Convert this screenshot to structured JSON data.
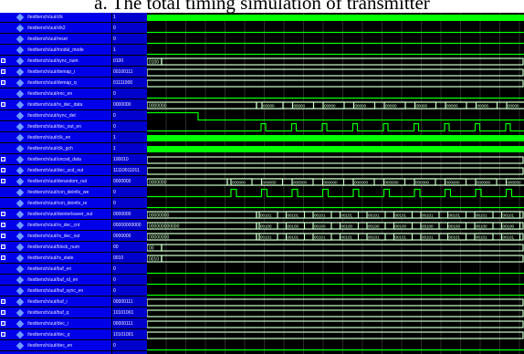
{
  "caption": "a.   The total timing simulation of transmitter",
  "signals": [
    {
      "name": "/testbench/uut/clk",
      "value": "1",
      "type": "clk",
      "expand": false
    },
    {
      "name": "/testbench/uut/clk2",
      "value": "0",
      "type": "low",
      "expand": false
    },
    {
      "name": "/testbench/uut/reset",
      "value": "0",
      "type": "low",
      "expand": false
    },
    {
      "name": "/testbench/uut/modul_mode",
      "value": "1",
      "type": "low",
      "expand": false
    },
    {
      "name": "/testbench/uut/sync_num",
      "value": "0100",
      "type": "bus_tail",
      "expand": true
    },
    {
      "name": "/testbench/uut/demap_i",
      "value": "00100111",
      "type": "bus",
      "expand": true
    },
    {
      "name": "/testbench/uut/demap_q",
      "value": "01111000",
      "type": "bus",
      "expand": true
    },
    {
      "name": "/testbench/uut/enc_en",
      "value": "0",
      "type": "low",
      "expand": false
    },
    {
      "name": "/testbench/uut/rs_dec_data",
      "value": "0000000",
      "type": "bus_seg",
      "expand": true
    },
    {
      "name": "/testbench/uut/sync_det",
      "value": "0",
      "type": "step",
      "expand": false
    },
    {
      "name": "/testbench/uut/dec_out_en",
      "value": "0",
      "type": "pulse",
      "expand": false
    },
    {
      "name": "/testbench/uut/clk_en",
      "value": "1",
      "type": "clk",
      "expand": false
    },
    {
      "name": "/testbench/uut/clk_gch",
      "value": "1",
      "type": "clk",
      "expand": false
    },
    {
      "name": "/testbench/uut/uncod_data",
      "value": "100010",
      "type": "bus",
      "expand": true
    },
    {
      "name": "/testbench/uut/dec_scd_out",
      "value": "11110011011",
      "type": "bus",
      "expand": true
    },
    {
      "name": "/testbench/uut/derandom_out",
      "value": "0000000",
      "type": "bus_seg2",
      "expand": true
    },
    {
      "name": "/testbench/uut/con_deintlv_we",
      "value": "0",
      "type": "pulse2",
      "expand": false
    },
    {
      "name": "/testbench/uut/con_deintlv_re",
      "value": "0",
      "type": "low",
      "expand": false
    },
    {
      "name": "/testbench/uut/deinterleaver_out",
      "value": "0000000",
      "type": "bus_seg3",
      "expand": true
    },
    {
      "name": "/testbench/uut/rs_dec_cnt",
      "value": "00000000000",
      "type": "bus_seg3",
      "expand": true
    },
    {
      "name": "/testbench/uut/rs_dec_out",
      "value": "0000000",
      "type": "bus_seg3",
      "expand": true
    },
    {
      "name": "/testbench/uut/block_num",
      "value": "00",
      "type": "bus_tail",
      "expand": true
    },
    {
      "name": "/testbench/uut/rs_state",
      "value": "0010",
      "type": "bus_tail",
      "expand": true
    },
    {
      "name": "/testbench/uut/buf_en",
      "value": "0",
      "type": "low",
      "expand": false
    },
    {
      "name": "/testbench/uut/buf_rd_en",
      "value": "0",
      "type": "low",
      "expand": false
    },
    {
      "name": "/testbench/uut/buf_sync_en",
      "value": "0",
      "type": "low",
      "expand": false
    },
    {
      "name": "/testbench/uut/buf_i",
      "value": "00000111",
      "type": "bus",
      "expand": true
    },
    {
      "name": "/testbench/uut/buf_q",
      "value": "10101001",
      "type": "bus",
      "expand": true
    },
    {
      "name": "/testbench/uut/dec_i",
      "value": "00000111",
      "type": "bus",
      "expand": true
    },
    {
      "name": "/testbench/uut/dec_q",
      "value": "10101001",
      "type": "bus",
      "expand": true
    },
    {
      "name": "/testbench/uut/dec_en",
      "value": "0",
      "type": "low",
      "expand": false
    }
  ],
  "bus_labels": {
    "sync_num": "0100",
    "rs_dec_data": "0000000",
    "rs_dec_seg": "00000",
    "derandom": "0000000",
    "derandom_seg": "000000",
    "deint": "00000000",
    "deint_seg": "00101",
    "cnt": "000000000000",
    "cnt_seg": "00100",
    "out": "00000000",
    "out_seg": "00101",
    "block": "00",
    "rs_state": "0010"
  },
  "colors": {
    "names_bg": "#0000e8",
    "values_bg": "#0000cc",
    "wave_bg": "#000000",
    "signal": "#00ff00",
    "bus": "#ccffcc"
  }
}
